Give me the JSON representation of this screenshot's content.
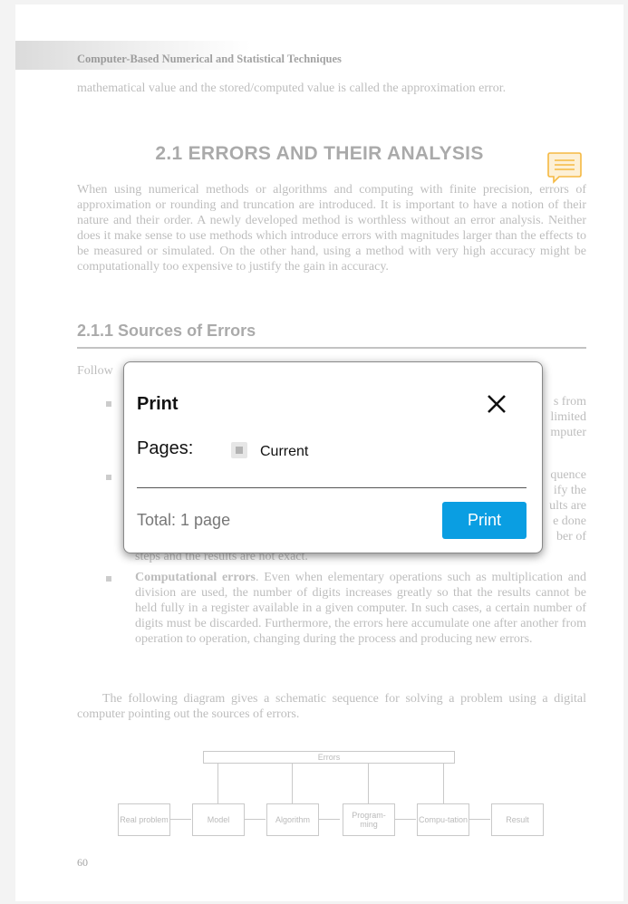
{
  "document": {
    "running_head": "Computer-Based Numerical and Statistical Techniques",
    "intro_text": "mathematical value and the stored/computed value is called the approximation error.",
    "section_title": "2.1 ERRORS AND THEIR ANALYSIS",
    "section_para": "When using numerical methods or algorithms and computing with finite precision, errors of approximation or rounding and truncation are introduced. It is important to have a notion of their nature and their order. A newly developed method is worthless without an error analysis. Neither does it make sense to use methods which introduce errors with magnitudes larger than the effects to be measured or simulated. On the other hand, using a method with very high accuracy might be computationally too expensive to justify the gain in accuracy.",
    "subsection_title": "2.1.1 Sources of Errors",
    "following_fragment": "Follow",
    "bullet1_fragments": [
      "s from",
      "limited",
      "mputer"
    ],
    "bullet2_fragments": [
      "quence",
      "ify the",
      "ults are",
      "e done",
      "ber of"
    ],
    "bullet2_last_line": "steps and the results are not exact.",
    "bullet3_title": "Computational errors",
    "bullet3_text": ". Even when elementary operations such as multiplication and division are used, the number of digits increases greatly so that the results cannot be held fully in a register available in a given computer. In such cases, a certain number of digits must be discarded. Furthermore, the errors here accumulate one after another from operation to operation, changing during the process and producing new errors.",
    "diagram_intro": "The following diagram gives a schematic sequence for solving a problem using a digital computer pointing out the sources of errors.",
    "page_number": "60"
  },
  "diagram": {
    "errors_label": "Errors",
    "steps": [
      "Real problem",
      "Model",
      "Algorithm",
      "Program-ming",
      "Compu-tation",
      "Result"
    ]
  },
  "dialog": {
    "title": "Print",
    "pages_label": "Pages:",
    "option_current": "Current",
    "total_text": "Total: 1 page",
    "print_button": "Print"
  },
  "icons": {
    "close": "close-icon",
    "note": "note-icon",
    "checkbox": "checkbox-icon"
  },
  "colors": {
    "accent": "#0a9ee2",
    "note": "#f5b942"
  }
}
